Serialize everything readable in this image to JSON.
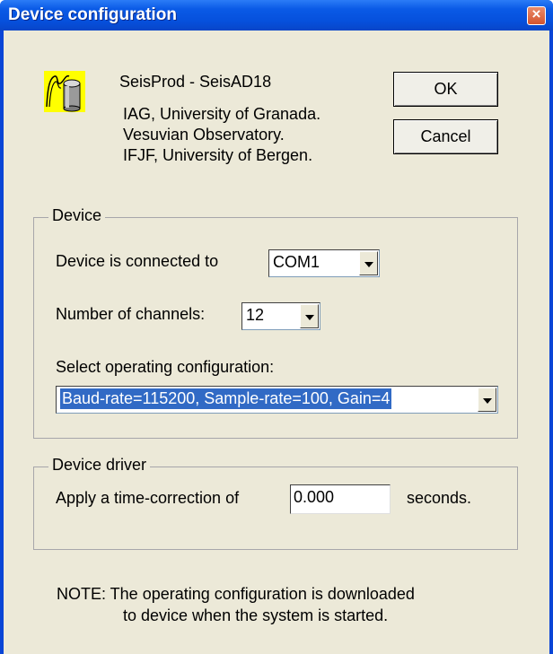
{
  "window": {
    "title": "Device configuration",
    "close_glyph": "×"
  },
  "header": {
    "app_name": "SeisProd - SeisAD18",
    "credits": [
      "IAG, University of Granada.",
      "Vesuvian Observatory.",
      "IFJF, University of Bergen."
    ],
    "icon": "seismometer-app-icon"
  },
  "buttons": {
    "ok": "OK",
    "cancel": "Cancel"
  },
  "device_group": {
    "label": "Device",
    "connected_label": "Device is connected to",
    "connected_value": "COM1",
    "channels_label": "Number of channels:",
    "channels_value": "12",
    "config_label": "Select operating configuration:",
    "config_value": "Baud-rate=115200, Sample-rate=100, Gain=4"
  },
  "driver_group": {
    "label": "Device driver",
    "correction_label": "Apply a time-correction of",
    "correction_value": "0.000",
    "seconds_label": "seconds."
  },
  "note": {
    "line1": "NOTE:  The operating configuration is downloaded",
    "line2": "to device when the system is started."
  },
  "colors": {
    "titlebar": "#0a5ae6",
    "face": "#ece9d8",
    "selection": "#316ac5"
  }
}
